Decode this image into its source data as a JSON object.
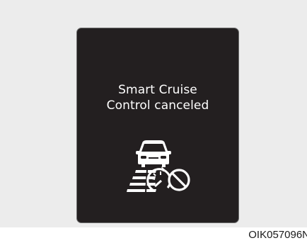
{
  "panel": {
    "message_line1": "Smart Cruise",
    "message_line2": "Control canceled",
    "icon": "smart-cruise-control-canceled-icon",
    "background_color": "#231f20",
    "text_color": "#ffffff"
  },
  "image_code": "OIK057096N"
}
